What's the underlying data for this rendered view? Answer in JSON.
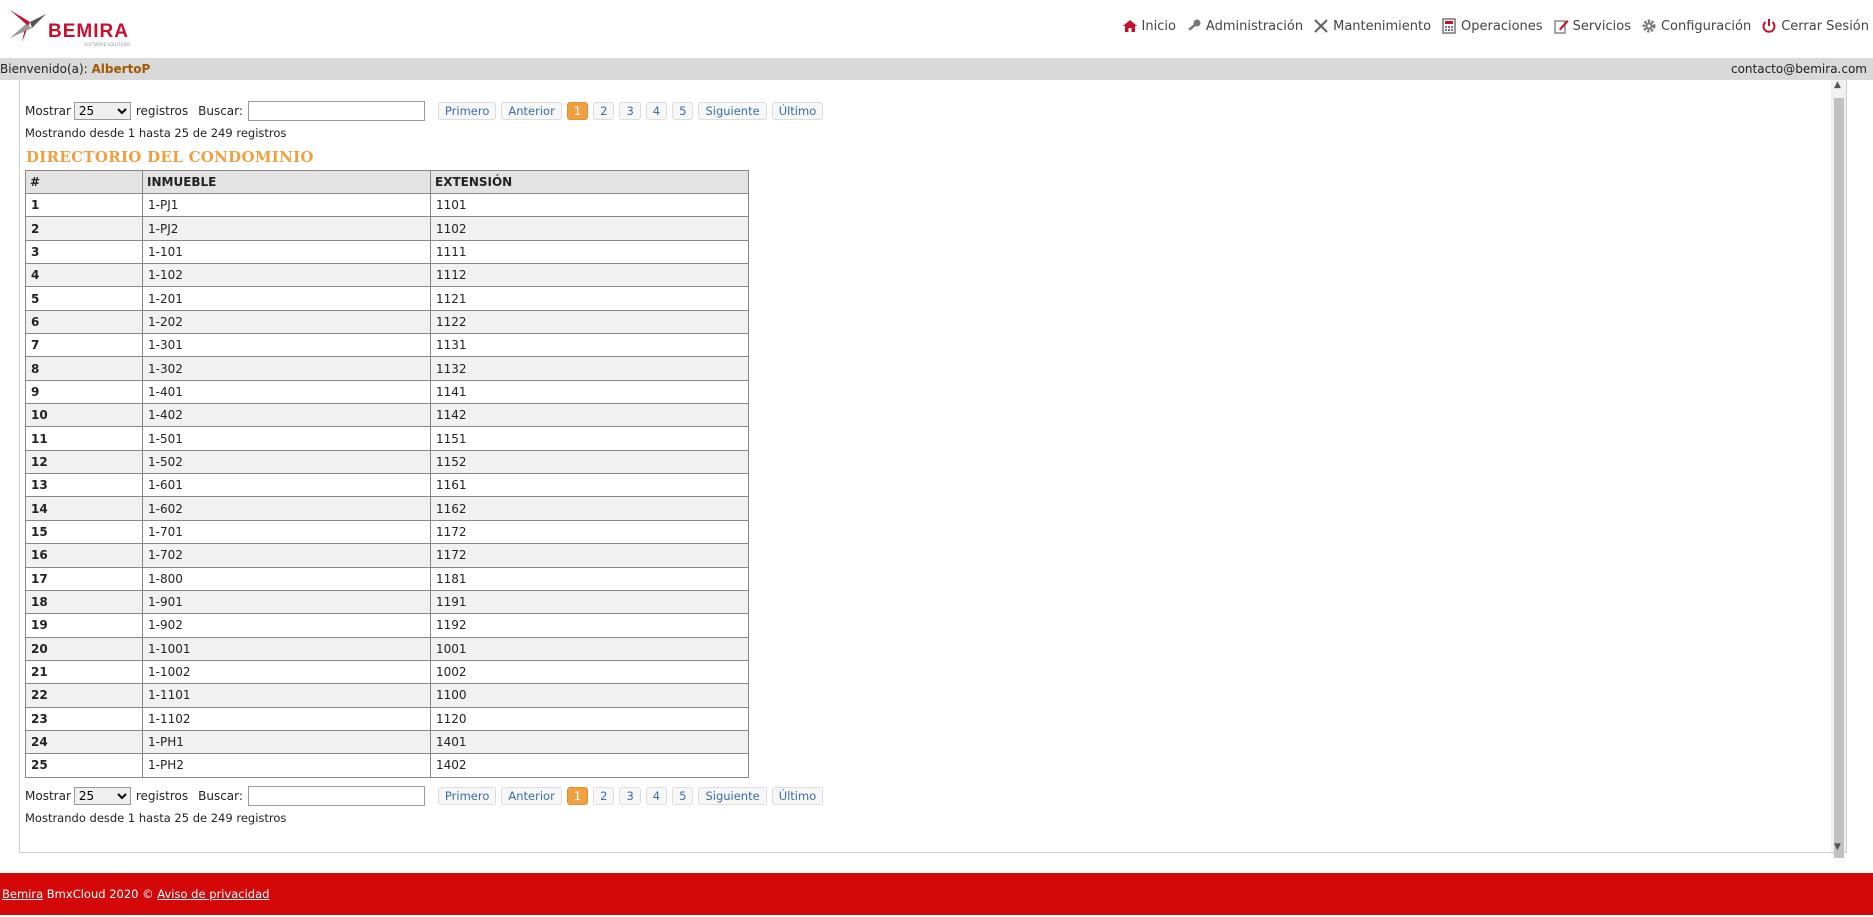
{
  "logo": {
    "name": "BEMIRA",
    "sub": "SOFTWARE SOLUTIONS"
  },
  "nav": [
    {
      "label": "Inicio",
      "icon": "home-icon"
    },
    {
      "label": "Administración",
      "icon": "key-icon"
    },
    {
      "label": "Mantenimiento",
      "icon": "tools-icon"
    },
    {
      "label": "Operaciones",
      "icon": "calculator-icon"
    },
    {
      "label": "Servicios",
      "icon": "edit-icon"
    },
    {
      "label": "Configuración",
      "icon": "gear-icon"
    },
    {
      "label": "Cerrar Sesión",
      "icon": "power-icon"
    }
  ],
  "welcome": {
    "prefix": "Bienvenido(a): ",
    "user": "AlbertoP",
    "email": "contacto@bemira.com"
  },
  "controls": {
    "show_label": "Mostrar",
    "show_value": "25",
    "records_label": "registros",
    "search_label": "Buscar:",
    "search_value": "",
    "first": "Primero",
    "prev": "Anterior",
    "pages": [
      "1",
      "2",
      "3",
      "4",
      "5"
    ],
    "next": "Siguiente",
    "last": "Último",
    "info": "Mostrando desde 1 hasta 25 de 249 registros"
  },
  "title": "DIRECTORIO DEL CONDOMINIO",
  "table": {
    "headers": [
      "#",
      "INMUEBLE",
      "EXTENSIÓN"
    ],
    "rows": [
      [
        "1",
        "1-PJ1",
        "1101"
      ],
      [
        "2",
        "1-PJ2",
        "1102"
      ],
      [
        "3",
        "1-101",
        "1111"
      ],
      [
        "4",
        "1-102",
        "1112"
      ],
      [
        "5",
        "1-201",
        "1121"
      ],
      [
        "6",
        "1-202",
        "1122"
      ],
      [
        "7",
        "1-301",
        "1131"
      ],
      [
        "8",
        "1-302",
        "1132"
      ],
      [
        "9",
        "1-401",
        "1141"
      ],
      [
        "10",
        "1-402",
        "1142"
      ],
      [
        "11",
        "1-501",
        "1151"
      ],
      [
        "12",
        "1-502",
        "1152"
      ],
      [
        "13",
        "1-601",
        "1161"
      ],
      [
        "14",
        "1-602",
        "1162"
      ],
      [
        "15",
        "1-701",
        "1172"
      ],
      [
        "16",
        "1-702",
        "1172"
      ],
      [
        "17",
        "1-800",
        "1181"
      ],
      [
        "18",
        "1-901",
        "1191"
      ],
      [
        "19",
        "1-902",
        "1192"
      ],
      [
        "20",
        "1-1001",
        "1001"
      ],
      [
        "21",
        "1-1002",
        "1002"
      ],
      [
        "22",
        "1-1101",
        "1100"
      ],
      [
        "23",
        "1-1102",
        "1120"
      ],
      [
        "24",
        "1-PH1",
        "1401"
      ],
      [
        "25",
        "1-PH2",
        "1402"
      ]
    ]
  },
  "footer": {
    "brand": "Bemira",
    "text": " BmxCloud 2020 © ",
    "privacy": "Aviso de privacidad"
  },
  "colors": {
    "accent": "#f0a040",
    "footer": "#d40808",
    "brand": "#c8102e"
  }
}
